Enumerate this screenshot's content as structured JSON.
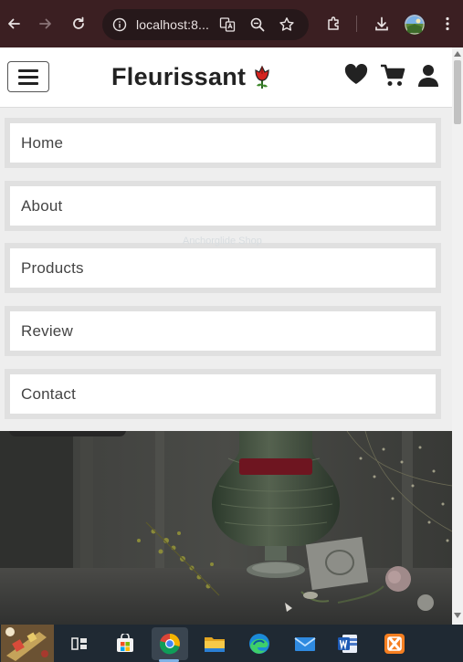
{
  "browser": {
    "url": "localhost:8...",
    "icons": [
      "back-icon",
      "forward-icon",
      "reload-icon",
      "site-info-icon",
      "translate-icon",
      "zoom-icon",
      "bookmark-star-icon",
      "extensions-icon",
      "download-icon",
      "profile-avatar",
      "more-menu-icon"
    ]
  },
  "header": {
    "brand": "Fleurissant",
    "icons": [
      "menu-toggle",
      "heart-icon",
      "cart-icon",
      "user-icon"
    ]
  },
  "nav": {
    "items": [
      {
        "label": "Home"
      },
      {
        "label": "About"
      },
      {
        "label": "Products"
      },
      {
        "label": "Review"
      },
      {
        "label": "Contact"
      }
    ]
  },
  "overlay_text": "Anchorglide Shop",
  "colors": {
    "chrome": "#3b1f22",
    "omnibox": "#26181a",
    "menu_bg": "#e0e0e0",
    "brand_text": "#222222",
    "taskbar": "#1f2933"
  },
  "taskbar": {
    "apps": [
      "widgets-icon",
      "task-view-icon",
      "store-icon",
      "chrome-icon",
      "file-explorer-icon",
      "edge-icon",
      "mail-icon",
      "word-icon",
      "xampp-icon"
    ]
  }
}
